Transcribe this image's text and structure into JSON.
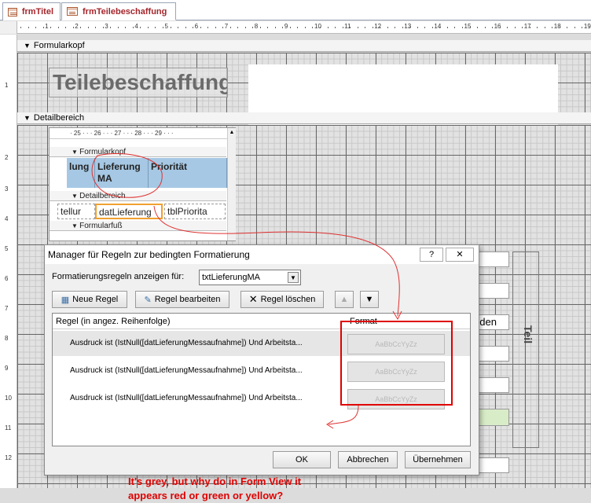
{
  "tabs": [
    {
      "label": "frmTitel"
    },
    {
      "label": "frmTeilebeschaffung"
    }
  ],
  "ruler": {
    "numbers": [
      "1",
      "2",
      "3",
      "4",
      "5",
      "6",
      "7",
      "8",
      "9",
      "10",
      "11",
      "12",
      "13",
      "14",
      "15",
      "16",
      "17",
      "18",
      "19"
    ],
    "vnumbers": [
      "1",
      "2",
      "3",
      "4",
      "5",
      "6",
      "7",
      "8",
      "9",
      "10",
      "11",
      "12"
    ]
  },
  "sections": {
    "header": "Formularkopf",
    "detail": "Detailbereich"
  },
  "form_title": "Teilebeschaffung",
  "subform": {
    "ruler_text": "· 25 · · · 26 · · · 27 · · · 28 · · · 29 · · ·",
    "header": "Formularkopf",
    "detail": "Detailbereich",
    "footer": "Formularfuß",
    "columns": [
      "lung",
      "Lieferung MA",
      "Priorität"
    ],
    "cells": [
      "tellur",
      "datLieferung",
      "tblPriorita"
    ]
  },
  "dialog": {
    "title": "Manager für Regeln zur bedingten Formatierung",
    "help": "?",
    "close": "✕",
    "filter_label": "Formatierungsregeln anzeigen für:",
    "filter_value": "txtLieferungMA",
    "btn_new": "Neue Regel",
    "btn_edit": "Regel bearbeiten",
    "btn_delete": "Regel löschen",
    "col_rule": "Regel (in angez. Reihenfolge)",
    "col_format": "Format",
    "rules": [
      {
        "text": "Ausdruck ist (IstNull([datLieferungMessaufnahme]) Und Arbeitsta...",
        "sample": "AaBbCcYyZz"
      },
      {
        "text": "Ausdruck ist (IstNull([datLieferungMessaufnahme]) Und Arbeitsta...",
        "sample": "AaBbCcYyZz"
      },
      {
        "text": "Ausdruck ist (IstNull([datLieferungMessaufnahme]) Und Arbeitsta...",
        "sample": "AaBbCcYyZz"
      }
    ],
    "note_line1": "It's grey, but why do in Form View it",
    "note_line2": "appears red or green or yellow?",
    "btn_ok": "OK",
    "btn_cancel": "Abbrechen",
    "btn_apply": "Übernehmen"
  },
  "right_controls": {
    "label_nden": "nden",
    "label_teil": "Teil"
  },
  "colors": {
    "tab_text": "#a4262c",
    "subform_header": "#a6c8e4",
    "highlight_orange": "#f0a030",
    "annotation_red": "#e00000"
  }
}
